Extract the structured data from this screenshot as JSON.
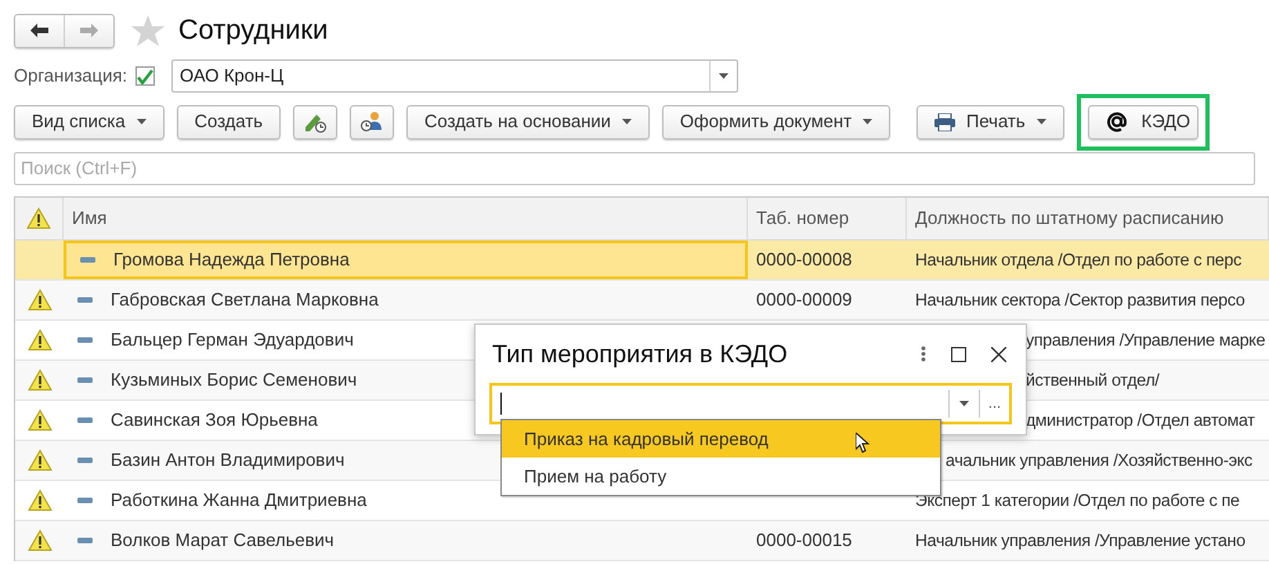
{
  "title": "Сотрудники",
  "organization": {
    "label": "Организация:",
    "checked": true,
    "value": "ОАО Крон-Ц"
  },
  "toolbar": [
    {
      "kind": "menu",
      "label": "Вид списка"
    },
    {
      "kind": "button",
      "label": "Создать"
    },
    {
      "kind": "pencil"
    },
    {
      "kind": "person"
    },
    {
      "kind": "menu",
      "label": "Создать на основании"
    },
    {
      "kind": "menu",
      "label": "Оформить документ"
    },
    {
      "kind": "print",
      "label": "Печать"
    },
    {
      "kind": "at",
      "label": "КЭДО",
      "highlighted": true
    }
  ],
  "search": {
    "placeholder": "Поиск (Ctrl+F)"
  },
  "table": {
    "columns": [
      "Имя",
      "Таб. номер",
      "Должность по штатному расписанию"
    ],
    "rows": [
      {
        "warning": false,
        "selected": true,
        "name": "Громова Надежда Петровна",
        "number": "0000-00008",
        "position": "Начальник отдела /Отдел по работе с перс"
      },
      {
        "warning": true,
        "selected": false,
        "name": "Габровская Светлана Марковна",
        "number": "0000-00009",
        "position": "Начальник сектора /Сектор развития персо"
      },
      {
        "warning": true,
        "selected": false,
        "name": "Бальцер Герман Эдуардович",
        "position": "управления /Управление марке",
        "covered_by_dialog": true
      },
      {
        "warning": true,
        "selected": false,
        "name": "Кузьминых Борис Семенович",
        "position": "йственный отдел/",
        "covered_by_dialog": true
      },
      {
        "warning": true,
        "selected": false,
        "name": "Савинская Зоя Юрьевна",
        "position": "дминистратор /Отдел автомат",
        "covered_by_dialog": true
      },
      {
        "warning": true,
        "selected": false,
        "name": "Базин Антон Владимирович",
        "position": "ачальник управления /Хозяйственно-экс",
        "covered_by_list": true
      },
      {
        "warning": true,
        "selected": false,
        "name": "Работкина Жанна Дмитриевна",
        "position": "Эксперт 1 категории /Отдел по работе с пе"
      },
      {
        "warning": true,
        "selected": false,
        "name": "Волков Марат Савельевич",
        "number": "0000-00015",
        "position": "Начальник управления /Управление устано"
      }
    ]
  },
  "dialog": {
    "title": "Тип мероприятия в КЭДО",
    "field_button": "...",
    "options": [
      {
        "label": "Приказ на кадровый перевод",
        "selected": true
      },
      {
        "label": "Прием на работу",
        "selected": false
      }
    ]
  }
}
